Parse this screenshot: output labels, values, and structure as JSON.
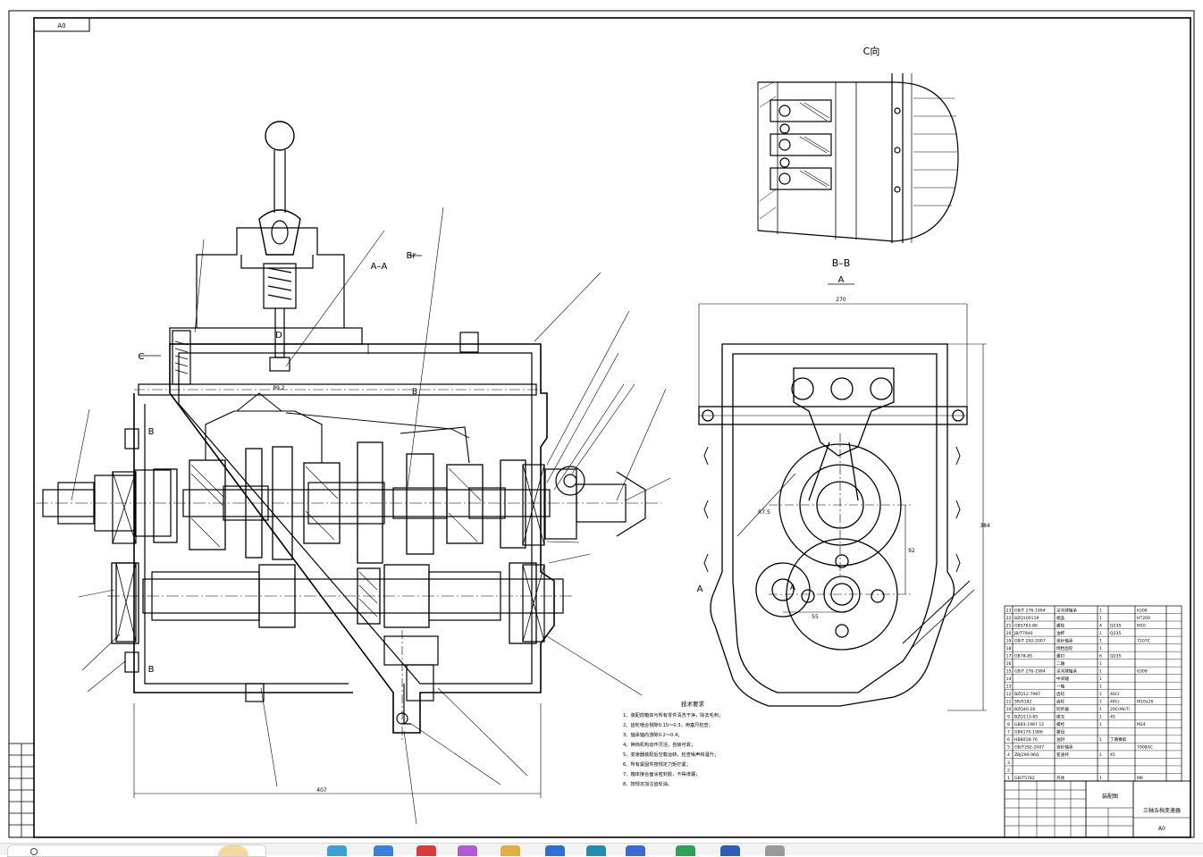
{
  "drawing": {
    "sheet_size": "A0",
    "view_c_label": "C向",
    "view_bb_label": "B–B",
    "view_aa_label": "A–A",
    "section_mark_a": "A",
    "section_mark_b": "B",
    "section_mark_c": "C",
    "section_mark_d": "D",
    "section_mark_br": "Br",
    "dim_total_length": "407",
    "dim_shift_rail": "89.2",
    "dim_width_bb": "270",
    "dim_height_bb": "384",
    "dim_center_dist": "92",
    "dim_offset": "55",
    "dim_radius": "R7.5",
    "tech_title": "技术要求",
    "tech_notes": [
      "1、装配前箱体与所有零件清洗干净，除去毛刺；",
      "2、齿轮啮合侧隙0.15～0.3，用塞尺检查；",
      "3、轴承轴向游隙0.2～0.4；",
      "4、换档机构动作灵活，自锁可靠；",
      "5、变速器装配后空载运转，检查噪声和温升；",
      "6、所有紧固件按规定力矩拧紧；",
      "7、箱体接合面涂密封胶，不得渗漏；",
      "8、按规定加注齿轮油。"
    ],
    "title_block_name": "三轴五档变速器",
    "title_block_label": "装配图",
    "title_block_sheet": "A0"
  },
  "bom": [
    [
      "23",
      "GB/T 276-1994",
      "深沟球轴承",
      "1",
      "",
      "6306"
    ],
    [
      "22",
      "BZQ100119",
      "端盖",
      "1",
      "",
      "HT200"
    ],
    [
      "21",
      "GB5783-86",
      "螺栓",
      "4",
      "Q235",
      "M10"
    ],
    [
      "20",
      "JB/T7940",
      "油杯",
      "1",
      "Q235",
      ""
    ],
    [
      "19",
      "GB/T 292-2007",
      "滚针轴承",
      "1",
      "",
      "7207C"
    ],
    [
      "18",
      "",
      "倒档齿轮",
      "1",
      "",
      ""
    ],
    [
      "17",
      "GB78-85",
      "螺钉",
      "6",
      "Q235",
      ""
    ],
    [
      "16",
      "",
      "二轴",
      "1",
      "",
      ""
    ],
    [
      "15",
      "GB/T 276-1994",
      "深沟球轴承",
      "1",
      "",
      "6309"
    ],
    [
      "14",
      "",
      "中间轴",
      "1",
      "",
      ""
    ],
    [
      "13",
      "",
      "一轴",
      "1",
      "",
      ""
    ],
    [
      "12",
      "BZQ12-7987",
      "齿轮",
      "1",
      "40Cr",
      ""
    ],
    [
      "11",
      "SR/0182",
      "齿轮",
      "1",
      "40Cr",
      "M10x26"
    ],
    [
      "10",
      "BZQ40-26",
      "同步器",
      "1",
      "20CrMnTi",
      ""
    ],
    [
      "9",
      "BZQ113-85",
      "拨叉",
      "1",
      "45",
      ""
    ],
    [
      "8",
      "GB83-1987 12",
      "螺栓",
      "1",
      "",
      "M24"
    ],
    [
      "7",
      "GB6170-1986",
      "螺母",
      "",
      "",
      ""
    ],
    [
      "6",
      "HB8018-76",
      "油封",
      "1",
      "丁腈橡胶",
      ""
    ],
    [
      "5",
      "GB/T292-2007",
      "滚针轴承",
      "",
      "",
      "7008AC"
    ],
    [
      "4",
      "ZBJ290-96Q",
      "变速杆",
      "1",
      "45",
      ""
    ],
    [
      "3",
      "",
      "",
      "",
      "",
      ""
    ],
    [
      "2",
      "",
      "",
      "",
      "",
      ""
    ],
    [
      "1",
      "GB/T5782",
      "壳体",
      "1",
      "",
      "M6"
    ]
  ],
  "taskbar": {
    "icons": [
      "weather-widget-icon",
      "explorer-icon",
      "edge-icon",
      "copilot-icon",
      "store-icon",
      "folder-icon",
      "mail-icon",
      "app-icon",
      "cad-icon",
      "viewer-icon",
      "doc-icon",
      "settings-icon"
    ],
    "colors": [
      "#f2d9a0",
      "#3aa0d9",
      "#3a7fd9",
      "#d93a3a",
      "#b05ad9",
      "#e0b040",
      "#2f6fd0",
      "#1f8fb0",
      "#3b6ad9",
      "#2fa05a",
      "#2d5fb0",
      "#9a9a9a"
    ]
  }
}
